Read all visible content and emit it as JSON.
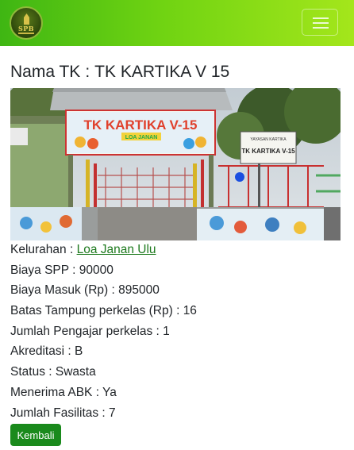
{
  "navbar": {
    "logo_text": "SPB"
  },
  "page": {
    "title_label": "Nama TK",
    "title_separator": ":",
    "title_value": "TK KARTIKA V 15"
  },
  "photo": {
    "sign_title": "TK KARTIKA V-15",
    "sign_subtitle": "LOA JANAN",
    "board_title": "TK KARTIKA V-15"
  },
  "details": [
    {
      "label": "Kelurahan",
      "value": "Loa Janan Ulu",
      "link": true
    },
    {
      "label": "Biaya SPP",
      "value": "90000"
    },
    {
      "label": "Biaya Masuk (Rp)",
      "value": "895000"
    },
    {
      "label": "Batas Tampung perkelas (Rp)",
      "value": "16"
    },
    {
      "label": "Jumlah Pengajar perkelas",
      "value": "1"
    },
    {
      "label": "Akreditasi",
      "value": "B"
    },
    {
      "label": "Status",
      "value": "Swasta"
    },
    {
      "label": "Menerima ABK",
      "value": "Ya"
    },
    {
      "label": "Jumlah Fasilitas",
      "value": "7"
    }
  ],
  "actions": {
    "back_label": "Kembali"
  },
  "colors": {
    "navbar_start": "#3fb613",
    "navbar_end": "#a4e61b",
    "link": "#1e7a1e",
    "button": "#1a8a1c"
  }
}
